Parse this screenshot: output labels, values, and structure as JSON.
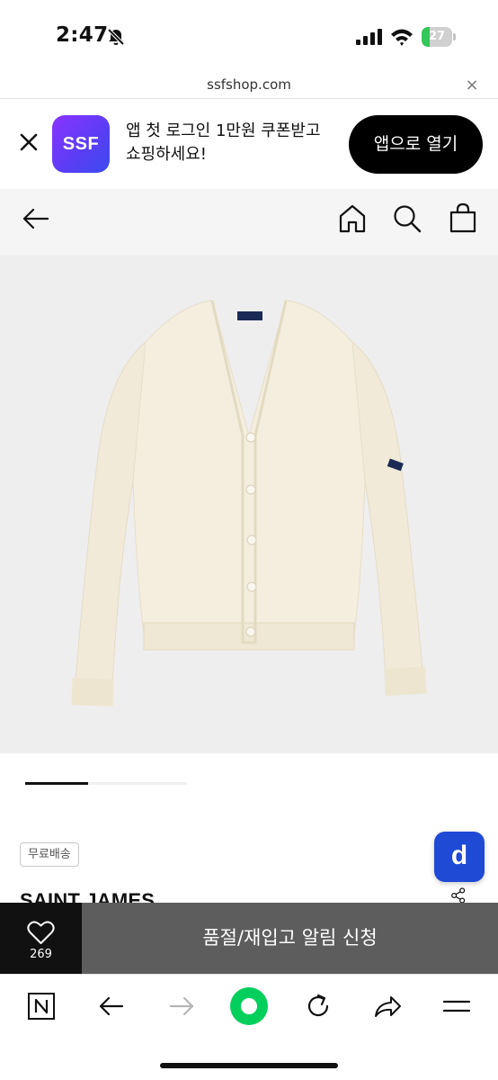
{
  "status_bar": {
    "time": "2:47",
    "battery_percent": "27",
    "battery_level": 0.27,
    "icons": [
      "bell-slash-icon",
      "signal-icon",
      "wifi-icon",
      "battery-icon"
    ]
  },
  "browser": {
    "url": "ssfshop.com",
    "close_symbol": "×"
  },
  "app_banner": {
    "logo_text": "SSF",
    "message_line1": "앱 첫 로그인 1만원 쿠폰받고",
    "message_line2": "쇼핑하세요!",
    "open_button": "앱으로 열기",
    "logo_gradient": [
      "#8a34ff",
      "#3b4bf0"
    ]
  },
  "header": {
    "icons": [
      "back-arrow-icon",
      "home-icon",
      "search-icon",
      "shopping-bag-icon"
    ]
  },
  "product": {
    "image_description_icon": "cardigan-image",
    "gallery_position": 1,
    "gallery_total": 3,
    "free_shipping": "무료배송",
    "brand": "SAINT JAMES",
    "floating_badge": "d"
  },
  "action_bar": {
    "wish_count": "269",
    "restock_label": "품절/재입고 알림 신청"
  },
  "toolbar": {
    "icons": [
      "naver-n-icon",
      "back-icon",
      "forward-icon",
      "green-dot-icon",
      "reload-icon",
      "share-icon",
      "menu-icon"
    ],
    "accent": "#03cf5d"
  }
}
